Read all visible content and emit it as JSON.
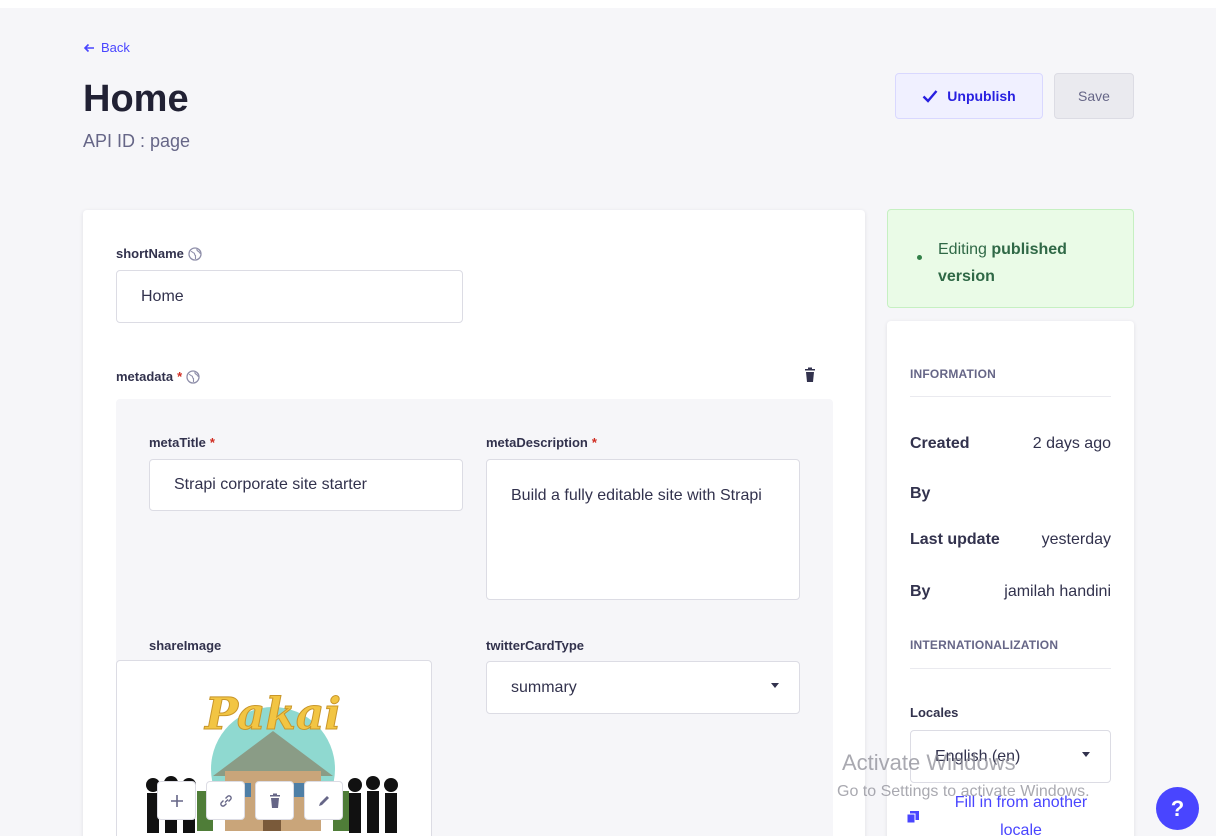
{
  "header": {
    "back_label": "Back",
    "title": "Home",
    "api_id": "API ID : page",
    "unpublish_label": "Unpublish",
    "save_label": "Save"
  },
  "form": {
    "shortName": {
      "label": "shortName",
      "value": "Home"
    },
    "metadata": {
      "label": "metadata",
      "required_mark": "*",
      "metaTitle": {
        "label": "metaTitle",
        "required_mark": "*",
        "value": "Strapi corporate site starter"
      },
      "metaDescription": {
        "label": "metaDescription",
        "required_mark": "*",
        "value": "Build a fully editable site with Strapi"
      },
      "shareImage": {
        "label": "shareImage",
        "logo_text": "Pakai"
      },
      "twitterCardType": {
        "label": "twitterCardType",
        "value": "summary"
      }
    }
  },
  "status": {
    "prefix": "Editing ",
    "emphasis": "published version"
  },
  "information": {
    "title": "INFORMATION",
    "created_label": "Created",
    "created_value": "2 days ago",
    "created_by_label": "By",
    "created_by_value": "",
    "updated_label": "Last update",
    "updated_value": "yesterday",
    "updated_by_label": "By",
    "updated_by_value": "jamilah handini"
  },
  "i18n": {
    "title": "INTERNATIONALIZATION",
    "locales_label": "Locales",
    "locale_value": "English (en)",
    "fill_label": "Fill in from another locale"
  },
  "watermark": {
    "line1": "Activate Windows",
    "line2": "Go to Settings to activate Windows."
  },
  "help_label": "?",
  "colors": {
    "primary": "#4945ff",
    "success_bg": "#eafbe7",
    "danger": "#d02b20"
  }
}
